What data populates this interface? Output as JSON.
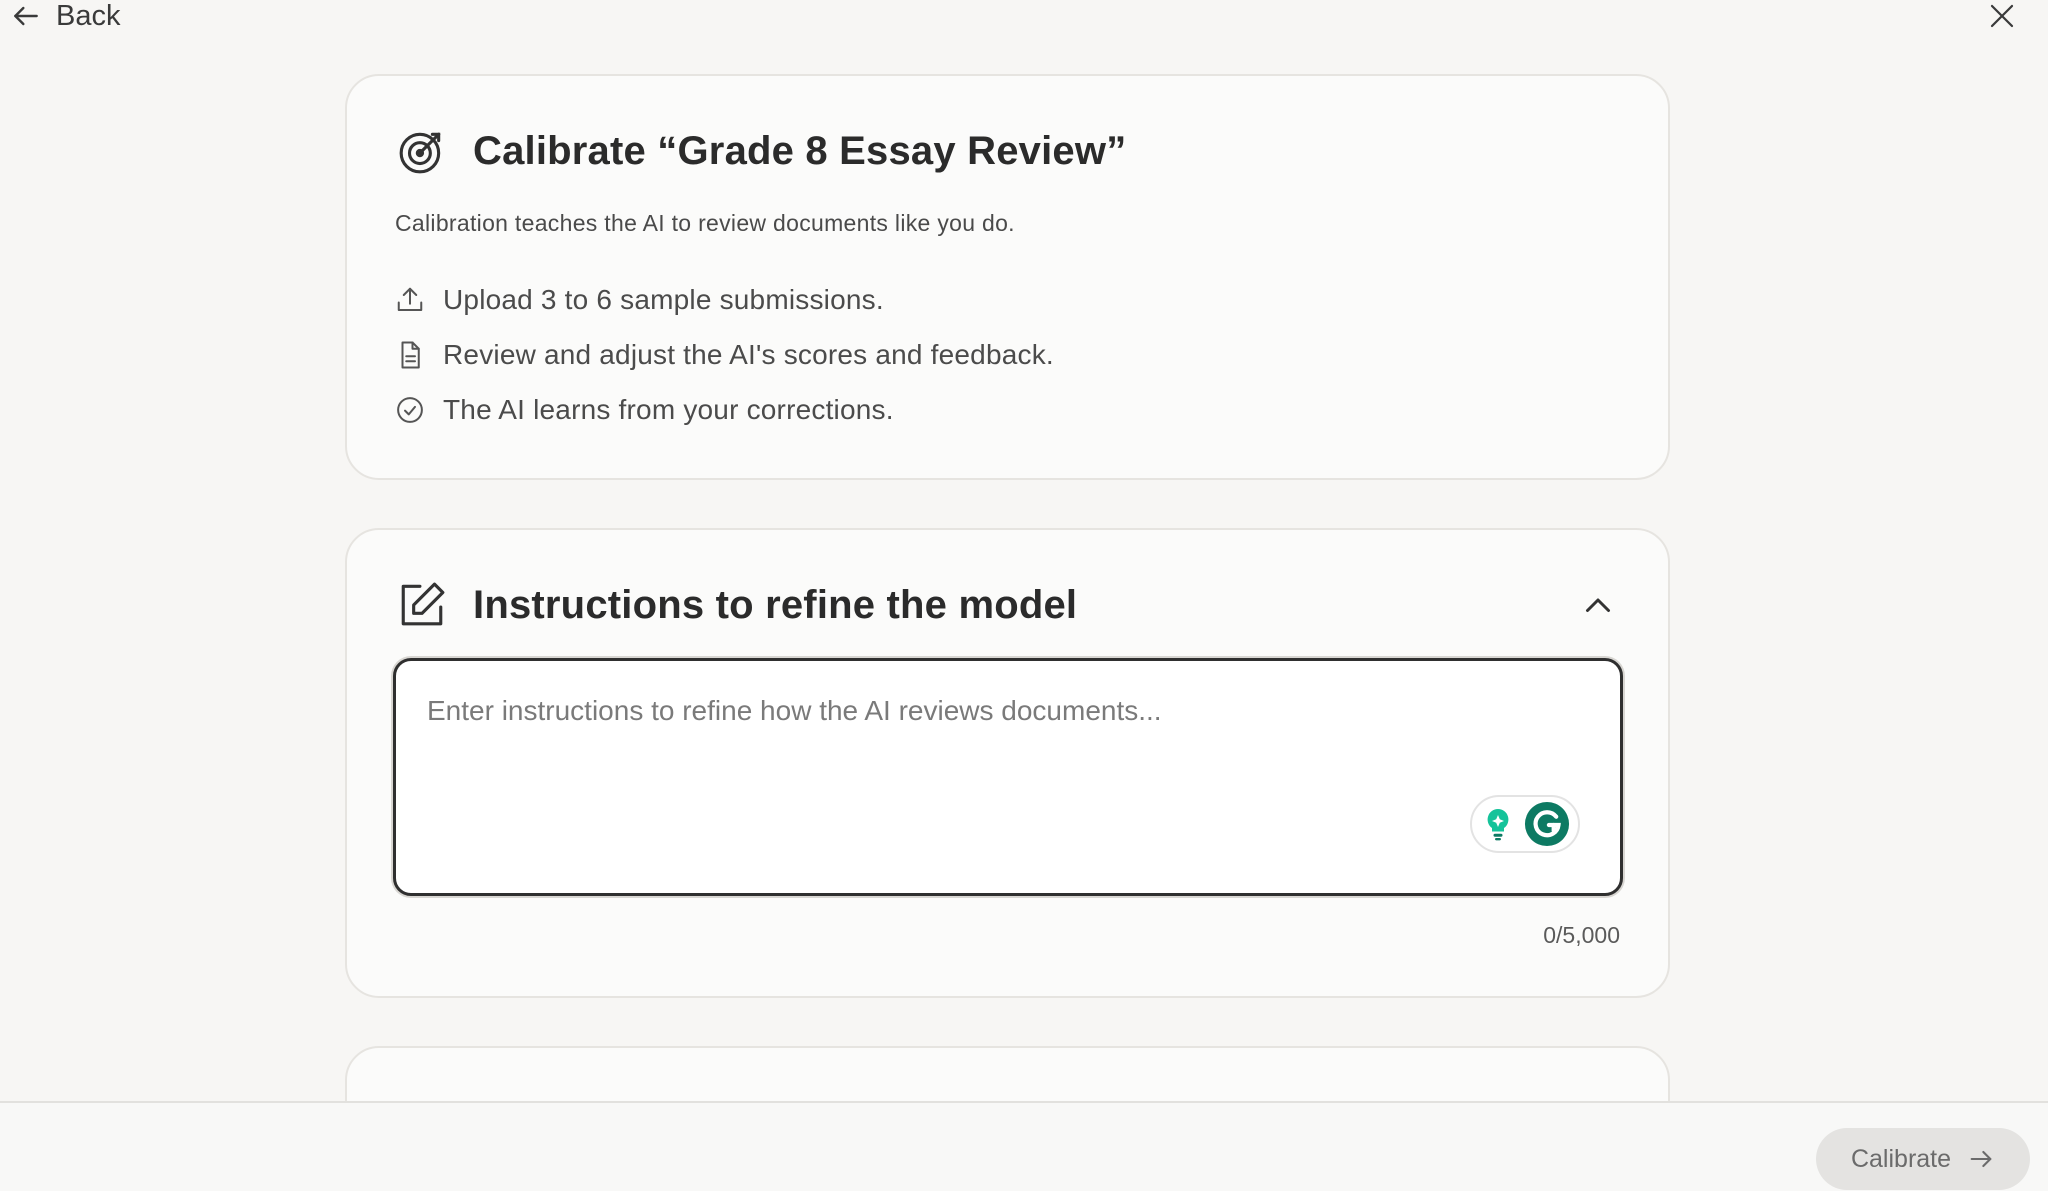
{
  "nav": {
    "back_label": "Back"
  },
  "intro": {
    "title": "Calibrate “Grade 8 Essay Review”",
    "description": "Calibration teaches the AI to review documents like you do.",
    "steps": [
      {
        "icon": "upload-icon",
        "text": "Upload 3 to 6 sample submissions."
      },
      {
        "icon": "document-icon",
        "text": "Review and adjust the AI's scores and feedback."
      },
      {
        "icon": "check-circle-icon",
        "text": "The AI learns from your corrections."
      }
    ]
  },
  "instructions": {
    "title": "Instructions to refine the model",
    "placeholder": "Enter instructions to refine how the AI reviews documents...",
    "value": "",
    "char_count": "0/5,000"
  },
  "footer": {
    "calibrate_label": "Calibrate"
  },
  "colors": {
    "background": "#f7f6f4",
    "card": "#fbfbfa",
    "grammarly_green": "#15c39a",
    "grammarly_dark": "#0d7a63",
    "button_disabled": "#e4e3e1"
  }
}
